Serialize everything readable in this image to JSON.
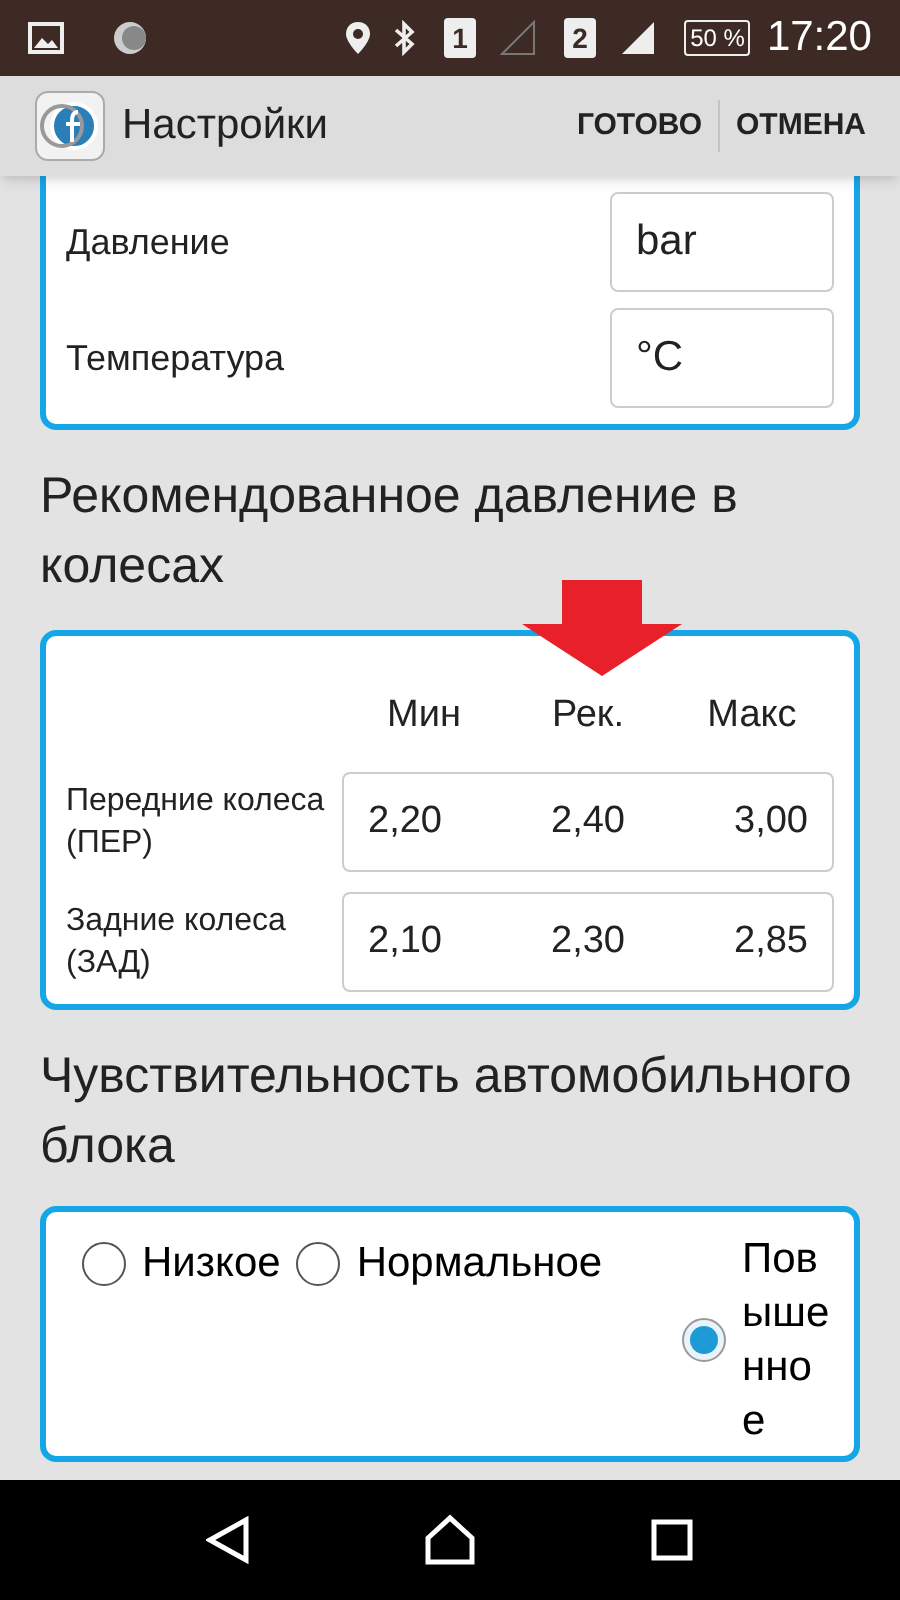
{
  "status_bar": {
    "sim_1": "1",
    "sim_2": "2",
    "battery": "50 %",
    "time": "17:20"
  },
  "app_bar": {
    "title": "Настройки",
    "actions": [
      "ГОТОВО",
      "ОТМЕНА"
    ]
  },
  "units": [
    {
      "label": "Давление",
      "value": "bar"
    },
    {
      "label": "Температура",
      "value": "°C"
    }
  ],
  "pressure": {
    "heading": "Рекомендованное давление в колесах",
    "columns": [
      "Мин",
      "Рек.",
      "Макс"
    ],
    "rows": [
      {
        "label": "Передние колеса (ПЕР)",
        "values": [
          "2,20",
          "2,40",
          "3,00"
        ]
      },
      {
        "label": "Задние колеса (ЗАД)",
        "values": [
          "2,10",
          "2,30",
          "2,85"
        ]
      }
    ]
  },
  "sensitivity": {
    "heading": "Чувствительность автомобильного блока",
    "options": [
      {
        "label": "Низкое",
        "selected": false
      },
      {
        "label": "Нормальное",
        "selected": false
      },
      {
        "label": "Повышенное",
        "selected": true
      }
    ]
  }
}
